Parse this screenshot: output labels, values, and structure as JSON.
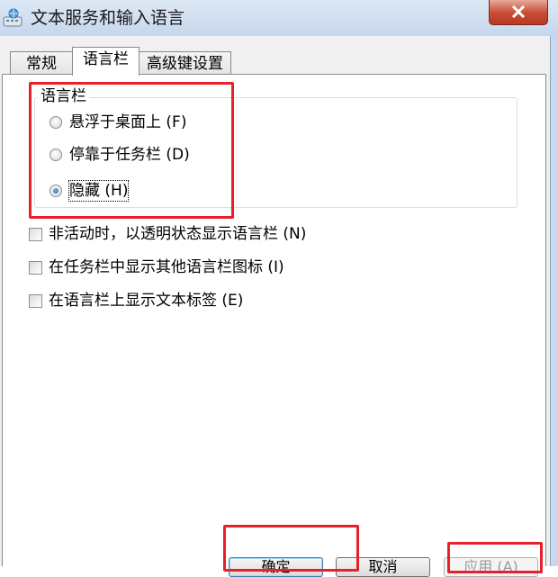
{
  "window": {
    "title": "文本服务和输入语言",
    "title_icon": "keyboard-globe-icon",
    "close_icon": "close-icon"
  },
  "tabs": [
    {
      "label": "常规",
      "active": false
    },
    {
      "label": "语言栏",
      "active": true
    },
    {
      "label": "高级键设置",
      "active": false
    }
  ],
  "language_bar_group": {
    "label": "语言栏",
    "options": [
      {
        "label": "悬浮于桌面上 (F)",
        "checked": false
      },
      {
        "label": "停靠于任务栏 (D)",
        "checked": false
      },
      {
        "label": "隐藏 (H)",
        "checked": true
      }
    ]
  },
  "checkboxes": [
    {
      "label": "非活动时，以透明状态显示语言栏 (N)",
      "checked": false
    },
    {
      "label": "在任务栏中显示其他语言栏图标 (I)",
      "checked": false
    },
    {
      "label": "在语言栏上显示文本标签 (E)",
      "checked": false
    }
  ],
  "buttons": {
    "ok": "确定",
    "cancel": "取消",
    "apply": "应用 (A)"
  },
  "colors": {
    "highlight_box": "#e8202a",
    "title_bar": "#c9d8ea",
    "close_button": "#c9503a"
  }
}
